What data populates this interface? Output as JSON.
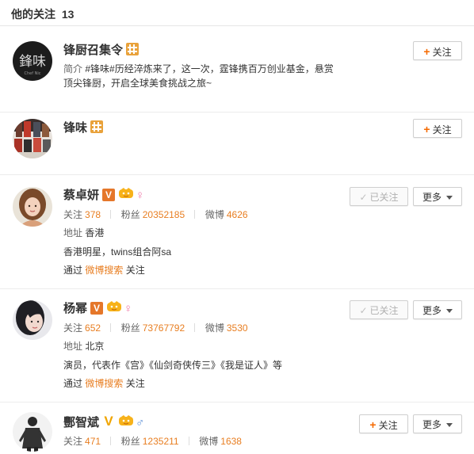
{
  "header": {
    "title": "他的关注",
    "count": "13"
  },
  "users": [
    {
      "name": "锋厨召集令",
      "intro_label": "简介",
      "intro_line1": "#锋味#历经淬炼来了，这一次，霆锋携百万创业基金，悬赏",
      "intro_line2": "顶尖锋厨，开启全球美食挑战之旅~",
      "follow_label": "关注"
    },
    {
      "name": "锋味",
      "follow_label": "关注"
    },
    {
      "name": "蔡卓妍",
      "v_badge": "V",
      "gender": "♀",
      "following_label": "关注",
      "following": "378",
      "fans_label": "粉丝",
      "fans": "20352185",
      "weibo_label": "微博",
      "weibo": "4626",
      "location_label": "地址",
      "location": "香港",
      "bio": "香港明星，twins组合阿sa",
      "via_prefix": "通过",
      "via_link": "微博搜索",
      "via_suffix": "关注",
      "followed_label": "已关注",
      "more_label": "更多"
    },
    {
      "name": "杨幂",
      "v_badge": "V",
      "gender": "♀",
      "following_label": "关注",
      "following": "652",
      "fans_label": "粉丝",
      "fans": "73767792",
      "weibo_label": "微博",
      "weibo": "3530",
      "location_label": "地址",
      "location": "北京",
      "bio": "演员，代表作《宫》《仙剑奇侠传三》《我是证人》等",
      "via_prefix": "通过",
      "via_link": "微博搜索",
      "via_suffix": "关注",
      "followed_label": "已关注",
      "more_label": "更多"
    },
    {
      "name": "酆智斌",
      "v_badge": "V",
      "gender": "♂",
      "following_label": "关注",
      "following": "471",
      "fans_label": "粉丝",
      "fans": "1235211",
      "weibo_label": "微博",
      "weibo": "1638",
      "follow_label": "关注",
      "more_label": "更多"
    }
  ],
  "colors": {
    "accent": "#e87e21",
    "plus": "#f56a00",
    "org_badge": "#e9a23b",
    "v_badge": "#e5772a"
  }
}
